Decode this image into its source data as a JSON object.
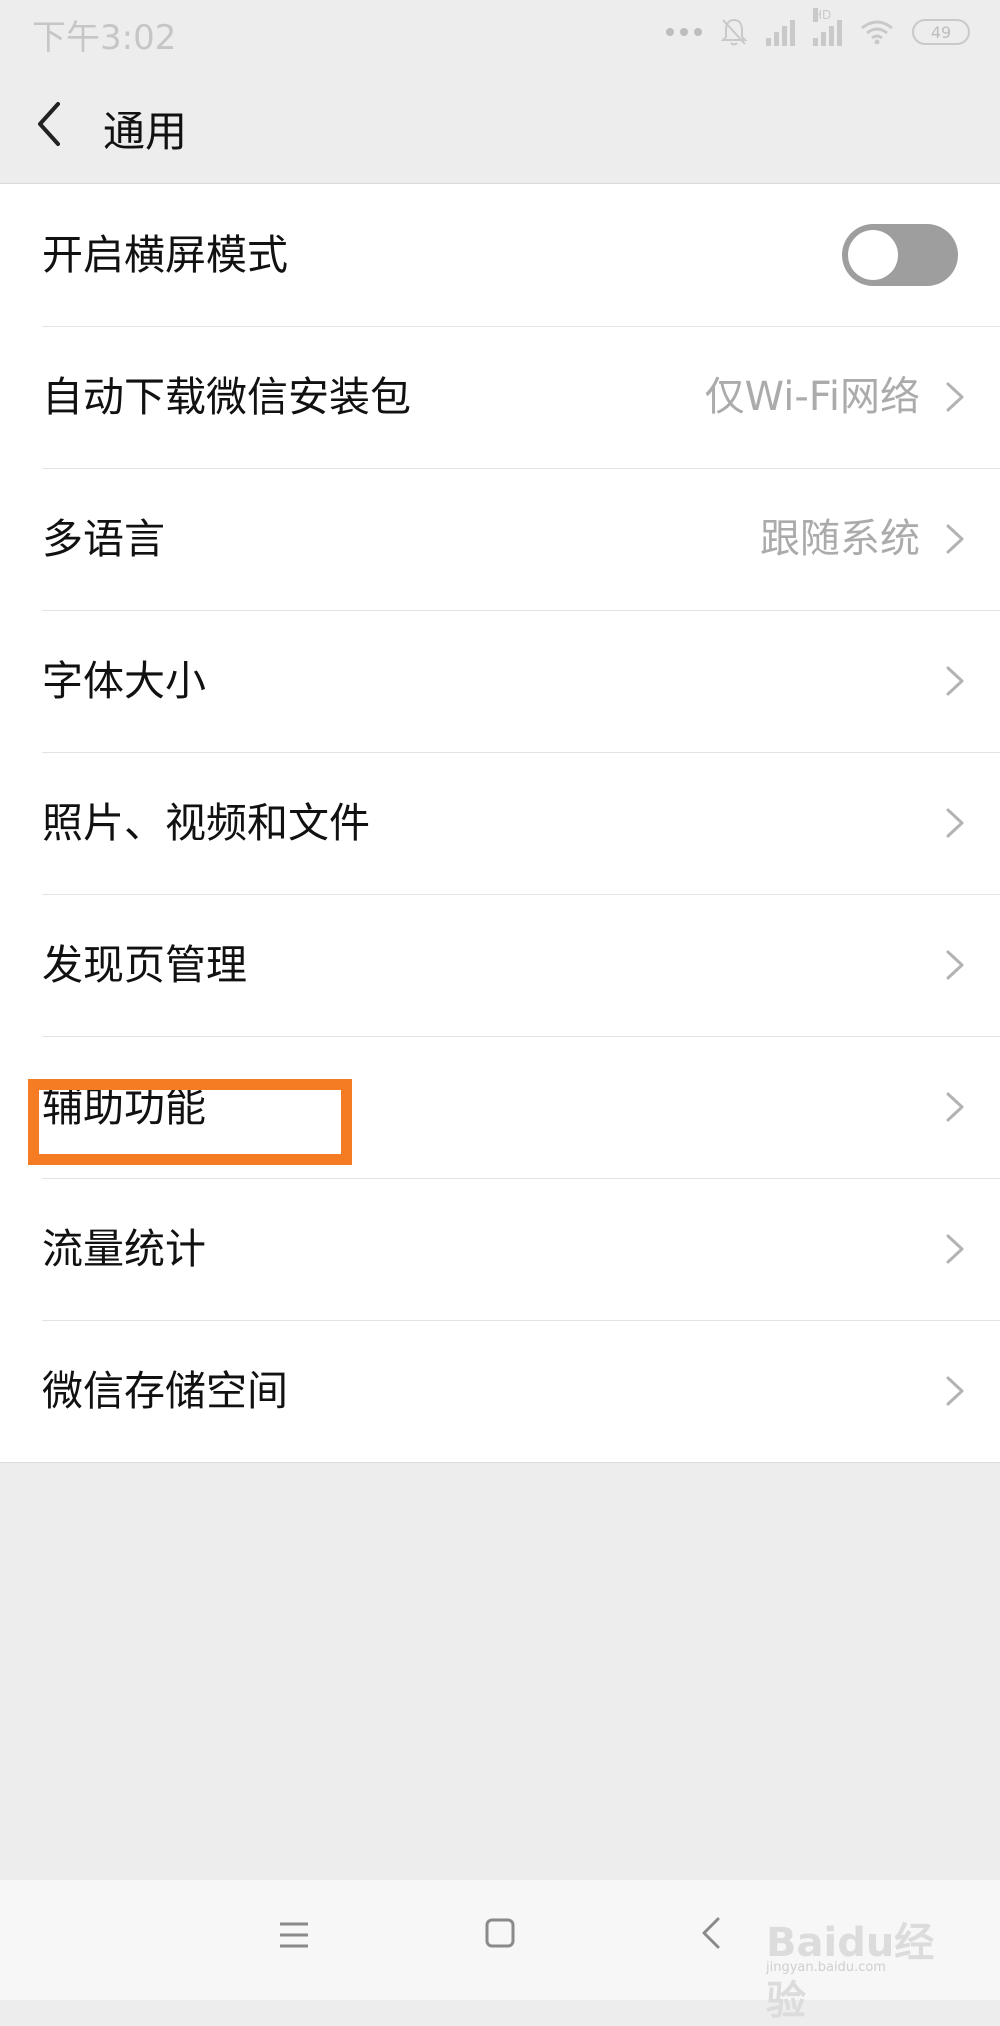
{
  "status_bar": {
    "time": "下午3:02",
    "battery": "49",
    "network_label": "HD"
  },
  "header": {
    "title": "通用"
  },
  "settings": [
    {
      "label": "开启横屏模式",
      "type": "toggle",
      "checked": false
    },
    {
      "label": "自动下载微信安装包",
      "value": "仅Wi-Fi网络"
    },
    {
      "label": "多语言",
      "value": "跟随系统"
    },
    {
      "label": "字体大小"
    },
    {
      "label": "照片、视频和文件"
    },
    {
      "label": "发现页管理"
    },
    {
      "label": "辅助功能",
      "highlighted": true
    },
    {
      "label": "流量统计"
    },
    {
      "label": "微信存储空间"
    }
  ],
  "highlight_color": "#f57c22",
  "watermark": {
    "brand": "Baidu经验",
    "url": "jingyan.baidu.com"
  }
}
